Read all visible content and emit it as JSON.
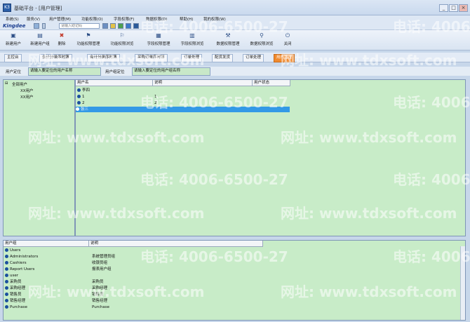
{
  "window": {
    "title": "基础平台 - [用户管理]",
    "app_icon": "K3",
    "min": "_",
    "max": "□",
    "close": "×"
  },
  "menu": [
    "系统(S)",
    "服务(V)",
    "用户管理(M)",
    "功能权限(O)",
    "字段权限(F)",
    "数据权限(D)",
    "帮助(H)",
    "我的权限(W)"
  ],
  "logo": "Kingdee",
  "search": {
    "placeholder": "请输入助记码"
  },
  "toolbar": [
    {
      "label": "新建用户",
      "icon": "new-user-icon",
      "glyph": "▣"
    },
    {
      "label": "新建用户组",
      "icon": "new-group-icon",
      "glyph": "▤"
    },
    {
      "label": "删除",
      "icon": "delete-icon",
      "glyph": "✖"
    },
    {
      "label": "功能权限管理",
      "icon": "function-permission-icon",
      "glyph": "⚑"
    },
    {
      "label": "功能权限浏览",
      "icon": "function-browse-icon",
      "glyph": "⚐"
    },
    {
      "label": "字段权限管理",
      "icon": "field-permission-icon",
      "glyph": "▦"
    },
    {
      "label": "字段权限浏览",
      "icon": "field-browse-icon",
      "glyph": "▥"
    },
    {
      "label": "数据权限管理",
      "icon": "data-permission-icon",
      "glyph": "⚒"
    },
    {
      "label": "数据权限浏览",
      "icon": "data-browse-icon",
      "glyph": "⚲"
    },
    {
      "label": "关闭",
      "icon": "close-icon",
      "glyph": "⏻"
    }
  ],
  "tabs": [
    "主控台",
    "会计分录序时簿",
    "会计分录序时簿",
    "采购订单序时簿",
    "订单处理",
    "配货发货",
    "订单处理",
    "用户管理"
  ],
  "filter": {
    "user_locate_label": "用户定位",
    "user_locate_placeholder": "请输入要定位的用户名称",
    "group_locate_label": "用户组定位",
    "group_locate_placeholder": "请输入要定位的用户组名称"
  },
  "tree": {
    "root": "全部用户",
    "children": [
      "XX用户",
      "XX用户"
    ]
  },
  "user_list": {
    "columns": [
      "用户名",
      "说明",
      "用户状态"
    ],
    "rows": [
      {
        "name": "李四",
        "desc": ""
      },
      {
        "name": "1",
        "desc": "1"
      },
      {
        "name": "2",
        "desc": "2"
      },
      {
        "name": "张三",
        "desc": ""
      }
    ],
    "selected_index": 3
  },
  "group_list": {
    "columns": [
      "用户组",
      "说明"
    ],
    "rows": [
      {
        "name": "Users",
        "desc": ""
      },
      {
        "name": "Administrators",
        "desc": "系统管理员组"
      },
      {
        "name": "Cashiers",
        "desc": "收银员组"
      },
      {
        "name": "Report Users",
        "desc": "报表用户组"
      },
      {
        "name": "user",
        "desc": ""
      },
      {
        "name": "采购员",
        "desc": "采购员"
      },
      {
        "name": "采购经理",
        "desc": "采购经理"
      },
      {
        "name": "销售员",
        "desc": "销售员"
      },
      {
        "name": "销售经理",
        "desc": "销售经理"
      },
      {
        "name": "Purchase",
        "desc": "Purchase"
      }
    ]
  },
  "watermark": {
    "phone": "电话: 4006-6500-27",
    "site": "网址: www.tdxsoft.com"
  }
}
